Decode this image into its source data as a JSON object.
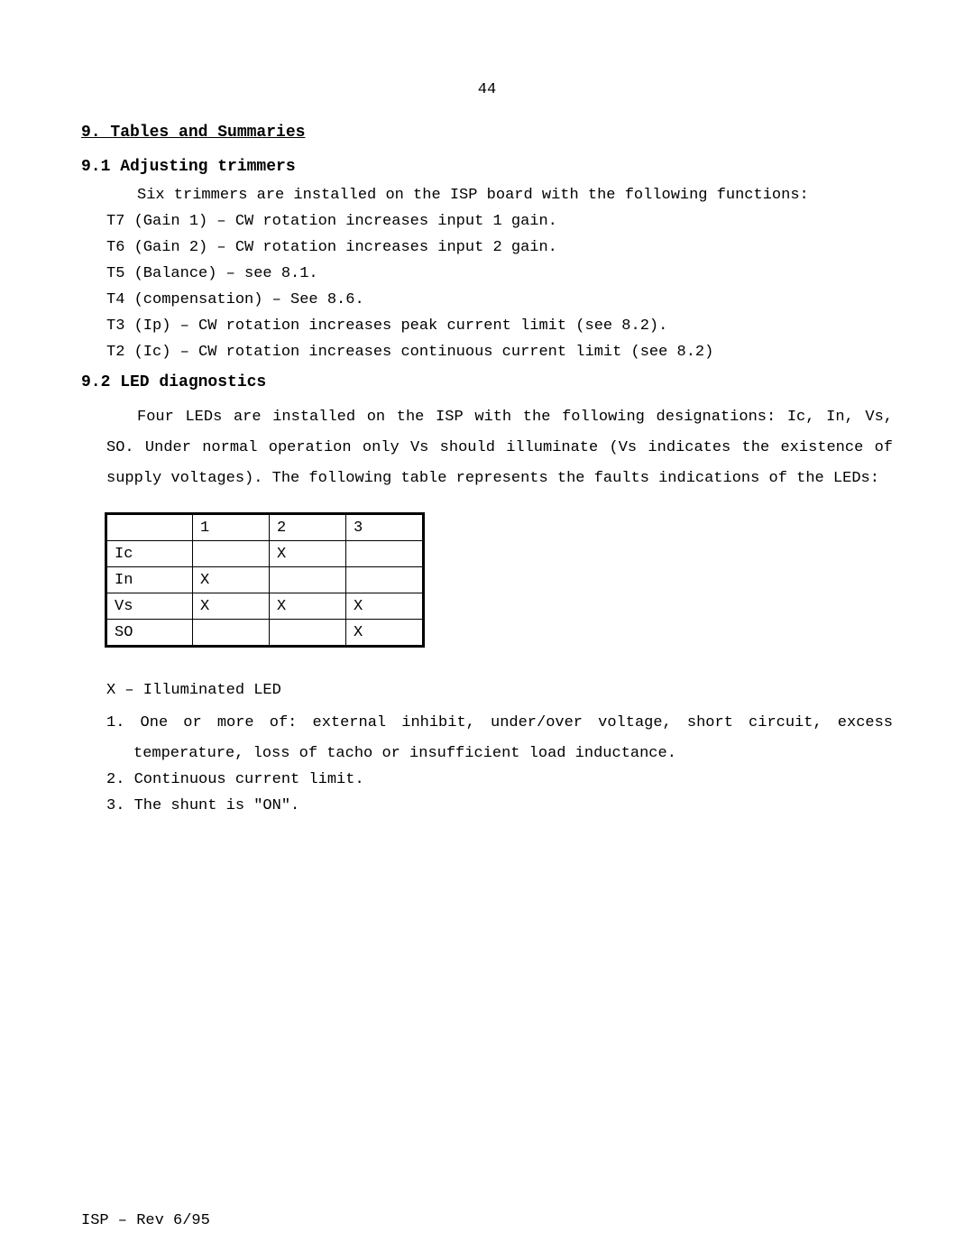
{
  "page_number": "44",
  "h1": "9.  Tables and Summaries",
  "s91": {
    "heading": "9.1  Adjusting trimmers",
    "intro": "Six trimmers are installed on the ISP board with the following functions:",
    "items": [
      "T7 (Gain 1) – CW rotation increases input 1 gain.",
      "T6 (Gain 2) – CW rotation increases input 2 gain.",
      "T5 (Balance) – see 8.1.",
      "T4 (compensation) – See 8.6.",
      "T3 (Ip) – CW rotation increases peak current limit (see 8.2).",
      "T2 (Ic) – CW rotation increases continuous current limit (see 8.2)"
    ]
  },
  "s92": {
    "heading": "9.2  LED diagnostics",
    "para": "Four LEDs are installed on the ISP with the following designations: Ic, In, Vs, SO. Under normal operation only Vs should illuminate (Vs indicates the existence of supply voltages). The following table represents the faults indications of the LEDs:",
    "table": {
      "cols": [
        "",
        "1",
        "2",
        "3"
      ],
      "rows": [
        {
          "label": "Ic",
          "c1": "",
          "c2": "X",
          "c3": ""
        },
        {
          "label": "In",
          "c1": "X",
          "c2": "",
          "c3": ""
        },
        {
          "label": "Vs",
          "c1": "X",
          "c2": "X",
          "c3": "X"
        },
        {
          "label": "SO",
          "c1": "",
          "c2": "",
          "c3": "X"
        }
      ]
    },
    "legend": "X – Illuminated LED",
    "notes": [
      "1. One or more of: external inhibit, under/over voltage, short circuit, excess temperature, loss of tacho or insufficient load inductance.",
      "2. Continuous current limit.",
      "3. The shunt is \"ON\"."
    ]
  },
  "footer": "ISP – Rev 6/95"
}
